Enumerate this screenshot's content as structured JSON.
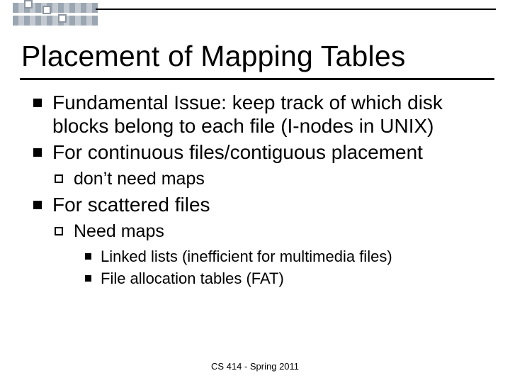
{
  "title": "Placement of Mapping Tables",
  "bullets": {
    "b1": "Fundamental Issue: keep track of which disk blocks belong to each file (I-nodes in UNIX)",
    "b2": "For continuous files/contiguous placement",
    "b2_1": "don’t need maps",
    "b3": "For scattered files",
    "b3_1": "Need maps",
    "b3_1_1": "Linked lists (inefficient for multimedia files)",
    "b3_1_2": "File allocation tables (FAT)"
  },
  "footer": "CS 414 - Spring 2011"
}
